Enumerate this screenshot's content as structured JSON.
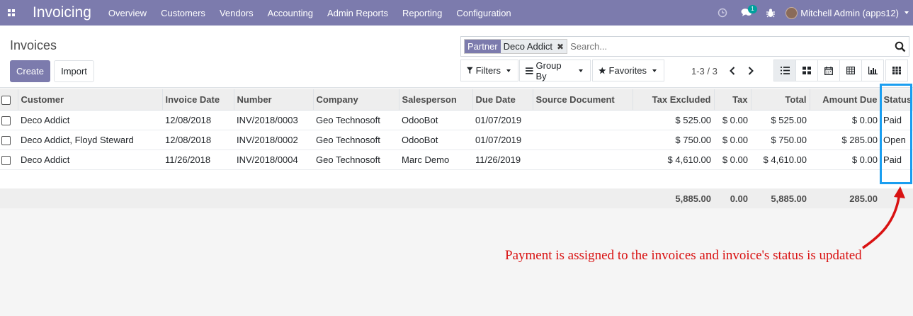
{
  "navbar": {
    "brand": "Invoicing",
    "menu": [
      "Overview",
      "Customers",
      "Vendors",
      "Accounting",
      "Admin Reports",
      "Reporting",
      "Configuration"
    ],
    "message_count": "1",
    "user": "Mitchell Admin (apps12)"
  },
  "page": {
    "title": "Invoices",
    "create_label": "Create",
    "import_label": "Import"
  },
  "search": {
    "facet_category": "Partner",
    "facet_value": "Deco Addict",
    "placeholder": "Search..."
  },
  "filters": {
    "filters_label": "Filters",
    "groupby_label": "Group By",
    "favorites_label": "Favorites"
  },
  "pager": {
    "value": "1-3 / 3"
  },
  "table": {
    "headers": {
      "customer": "Customer",
      "invoice_date": "Invoice Date",
      "number": "Number",
      "company": "Company",
      "salesperson": "Salesperson",
      "due_date": "Due Date",
      "source_document": "Source Document",
      "tax_excluded": "Tax Excluded",
      "tax": "Tax",
      "total": "Total",
      "amount_due": "Amount Due",
      "status": "Status"
    },
    "rows": [
      {
        "customer": "Deco Addict",
        "invoice_date": "12/08/2018",
        "number": "INV/2018/0003",
        "company": "Geo Technosoft",
        "salesperson": "OdooBot",
        "due_date": "01/07/2019",
        "source_document": "",
        "tax_excluded": "$ 525.00",
        "tax": "$ 0.00",
        "total": "$ 525.00",
        "amount_due": "$ 0.00",
        "status": "Paid"
      },
      {
        "customer": "Deco Addict, Floyd Steward",
        "invoice_date": "12/08/2018",
        "number": "INV/2018/0002",
        "company": "Geo Technosoft",
        "salesperson": "OdooBot",
        "due_date": "01/07/2019",
        "source_document": "",
        "tax_excluded": "$ 750.00",
        "tax": "$ 0.00",
        "total": "$ 750.00",
        "amount_due": "$ 285.00",
        "status": "Open"
      },
      {
        "customer": "Deco Addict",
        "invoice_date": "11/26/2018",
        "number": "INV/2018/0004",
        "company": "Geo Technosoft",
        "salesperson": "Marc Demo",
        "due_date": "11/26/2019",
        "source_document": "",
        "tax_excluded": "$ 4,610.00",
        "tax": "$ 0.00",
        "total": "$ 4,610.00",
        "amount_due": "$ 0.00",
        "status": "Paid"
      }
    ],
    "footer": {
      "tax_excluded": "5,885.00",
      "tax": "0.00",
      "total": "5,885.00",
      "amount_due": "285.00"
    }
  },
  "annotation": {
    "text": "Payment is assigned to the invoices and invoice's status is updated",
    "highlight_color": "#1a9ef0",
    "text_color": "#d91212"
  },
  "colors": {
    "brand": "#7c7bad",
    "badge": "#00a09d"
  }
}
